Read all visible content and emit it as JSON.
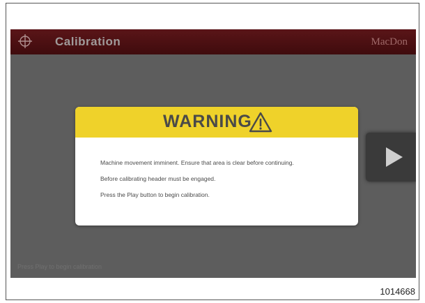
{
  "header": {
    "title": "Calibration",
    "brand": "MacDon",
    "icon": "crosshair-icon"
  },
  "dialog": {
    "title": "WARNING",
    "icon": "warning-triangle-icon",
    "messages": [
      "Machine movement imminent. Ensure that area is clear before continuing.",
      "Before calibrating header must be engaged.",
      "Press the Play button to begin calibration."
    ]
  },
  "controls": {
    "play_icon": "play-icon"
  },
  "status_bar": {
    "text": "Press Play to begin calibration"
  },
  "figure": {
    "reference": "1014668"
  },
  "colors": {
    "header": "#4e1114",
    "warning_yellow": "#efd22a",
    "screen": "#5d5d5d"
  }
}
